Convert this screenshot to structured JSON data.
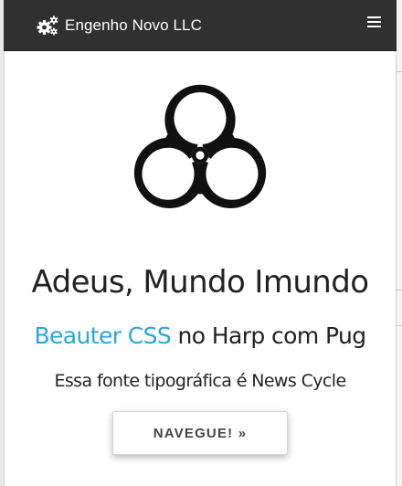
{
  "navbar": {
    "brand": {
      "icon": "cogs-icon",
      "label": "Engenho Novo LLC"
    },
    "menu_icon": "hamburger-menu-icon"
  },
  "hero": {
    "image_icon": "biohazard-icon",
    "title": "Adeus, Mundo Imundo",
    "subtitle": {
      "accent": "Beauter CSS",
      "rest": " no Harp com Pug"
    },
    "lead": "Essa fonte tipográfica é News Cycle",
    "cta_label": "NAVEGUE! »"
  },
  "colors": {
    "navbar_background": "#303030",
    "accent": "#2aa6d6",
    "text": "#222222",
    "button_text": "#444444"
  }
}
